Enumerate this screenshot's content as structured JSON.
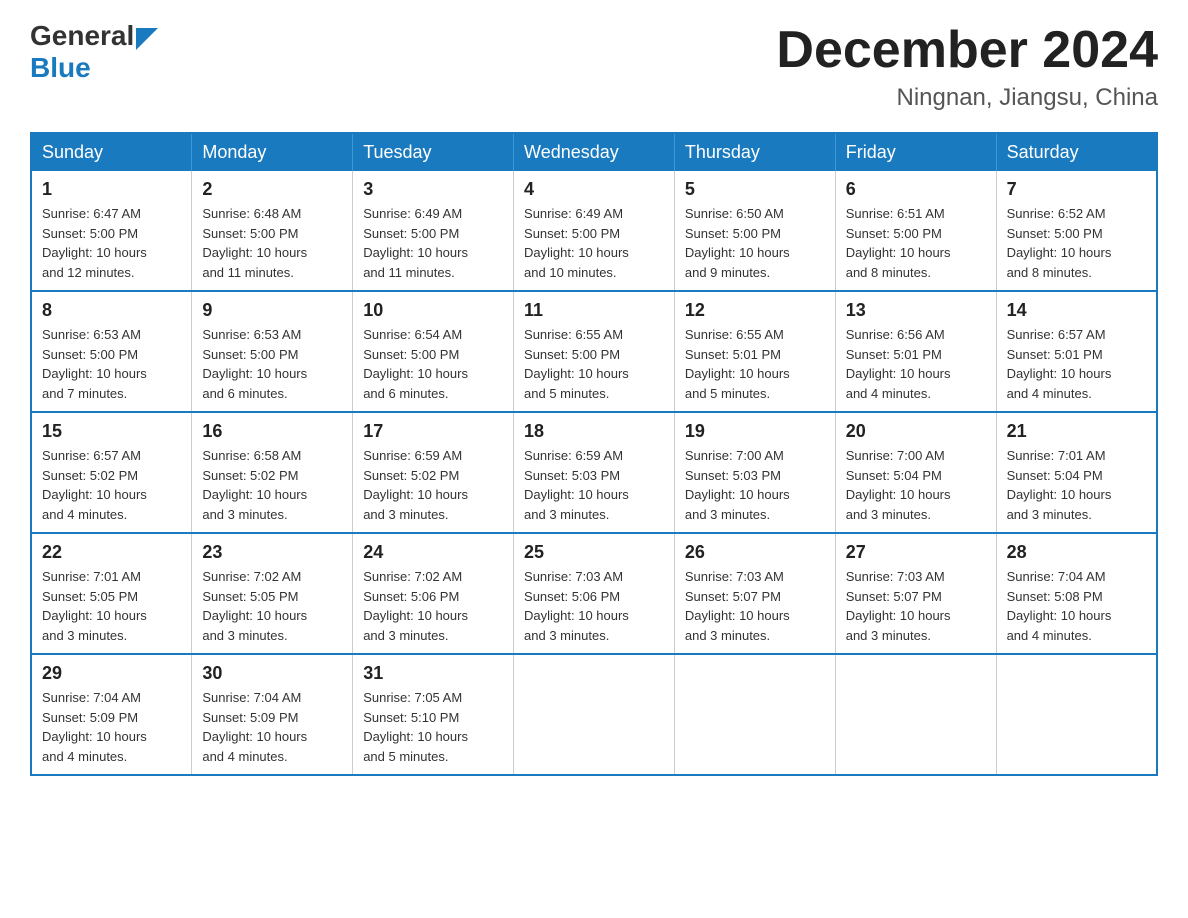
{
  "header": {
    "logo": {
      "general": "General",
      "blue": "Blue"
    },
    "title": "December 2024",
    "subtitle": "Ningnan, Jiangsu, China"
  },
  "weekdays": [
    "Sunday",
    "Monday",
    "Tuesday",
    "Wednesday",
    "Thursday",
    "Friday",
    "Saturday"
  ],
  "weeks": [
    [
      {
        "day": "1",
        "sunrise": "6:47 AM",
        "sunset": "5:00 PM",
        "daylight": "10 hours and 12 minutes."
      },
      {
        "day": "2",
        "sunrise": "6:48 AM",
        "sunset": "5:00 PM",
        "daylight": "10 hours and 11 minutes."
      },
      {
        "day": "3",
        "sunrise": "6:49 AM",
        "sunset": "5:00 PM",
        "daylight": "10 hours and 11 minutes."
      },
      {
        "day": "4",
        "sunrise": "6:49 AM",
        "sunset": "5:00 PM",
        "daylight": "10 hours and 10 minutes."
      },
      {
        "day": "5",
        "sunrise": "6:50 AM",
        "sunset": "5:00 PM",
        "daylight": "10 hours and 9 minutes."
      },
      {
        "day": "6",
        "sunrise": "6:51 AM",
        "sunset": "5:00 PM",
        "daylight": "10 hours and 8 minutes."
      },
      {
        "day": "7",
        "sunrise": "6:52 AM",
        "sunset": "5:00 PM",
        "daylight": "10 hours and 8 minutes."
      }
    ],
    [
      {
        "day": "8",
        "sunrise": "6:53 AM",
        "sunset": "5:00 PM",
        "daylight": "10 hours and 7 minutes."
      },
      {
        "day": "9",
        "sunrise": "6:53 AM",
        "sunset": "5:00 PM",
        "daylight": "10 hours and 6 minutes."
      },
      {
        "day": "10",
        "sunrise": "6:54 AM",
        "sunset": "5:00 PM",
        "daylight": "10 hours and 6 minutes."
      },
      {
        "day": "11",
        "sunrise": "6:55 AM",
        "sunset": "5:00 PM",
        "daylight": "10 hours and 5 minutes."
      },
      {
        "day": "12",
        "sunrise": "6:55 AM",
        "sunset": "5:01 PM",
        "daylight": "10 hours and 5 minutes."
      },
      {
        "day": "13",
        "sunrise": "6:56 AM",
        "sunset": "5:01 PM",
        "daylight": "10 hours and 4 minutes."
      },
      {
        "day": "14",
        "sunrise": "6:57 AM",
        "sunset": "5:01 PM",
        "daylight": "10 hours and 4 minutes."
      }
    ],
    [
      {
        "day": "15",
        "sunrise": "6:57 AM",
        "sunset": "5:02 PM",
        "daylight": "10 hours and 4 minutes."
      },
      {
        "day": "16",
        "sunrise": "6:58 AM",
        "sunset": "5:02 PM",
        "daylight": "10 hours and 3 minutes."
      },
      {
        "day": "17",
        "sunrise": "6:59 AM",
        "sunset": "5:02 PM",
        "daylight": "10 hours and 3 minutes."
      },
      {
        "day": "18",
        "sunrise": "6:59 AM",
        "sunset": "5:03 PM",
        "daylight": "10 hours and 3 minutes."
      },
      {
        "day": "19",
        "sunrise": "7:00 AM",
        "sunset": "5:03 PM",
        "daylight": "10 hours and 3 minutes."
      },
      {
        "day": "20",
        "sunrise": "7:00 AM",
        "sunset": "5:04 PM",
        "daylight": "10 hours and 3 minutes."
      },
      {
        "day": "21",
        "sunrise": "7:01 AM",
        "sunset": "5:04 PM",
        "daylight": "10 hours and 3 minutes."
      }
    ],
    [
      {
        "day": "22",
        "sunrise": "7:01 AM",
        "sunset": "5:05 PM",
        "daylight": "10 hours and 3 minutes."
      },
      {
        "day": "23",
        "sunrise": "7:02 AM",
        "sunset": "5:05 PM",
        "daylight": "10 hours and 3 minutes."
      },
      {
        "day": "24",
        "sunrise": "7:02 AM",
        "sunset": "5:06 PM",
        "daylight": "10 hours and 3 minutes."
      },
      {
        "day": "25",
        "sunrise": "7:03 AM",
        "sunset": "5:06 PM",
        "daylight": "10 hours and 3 minutes."
      },
      {
        "day": "26",
        "sunrise": "7:03 AM",
        "sunset": "5:07 PM",
        "daylight": "10 hours and 3 minutes."
      },
      {
        "day": "27",
        "sunrise": "7:03 AM",
        "sunset": "5:07 PM",
        "daylight": "10 hours and 3 minutes."
      },
      {
        "day": "28",
        "sunrise": "7:04 AM",
        "sunset": "5:08 PM",
        "daylight": "10 hours and 4 minutes."
      }
    ],
    [
      {
        "day": "29",
        "sunrise": "7:04 AM",
        "sunset": "5:09 PM",
        "daylight": "10 hours and 4 minutes."
      },
      {
        "day": "30",
        "sunrise": "7:04 AM",
        "sunset": "5:09 PM",
        "daylight": "10 hours and 4 minutes."
      },
      {
        "day": "31",
        "sunrise": "7:05 AM",
        "sunset": "5:10 PM",
        "daylight": "10 hours and 5 minutes."
      },
      null,
      null,
      null,
      null
    ]
  ],
  "labels": {
    "sunrise": "Sunrise:",
    "sunset": "Sunset:",
    "daylight": "Daylight:"
  }
}
